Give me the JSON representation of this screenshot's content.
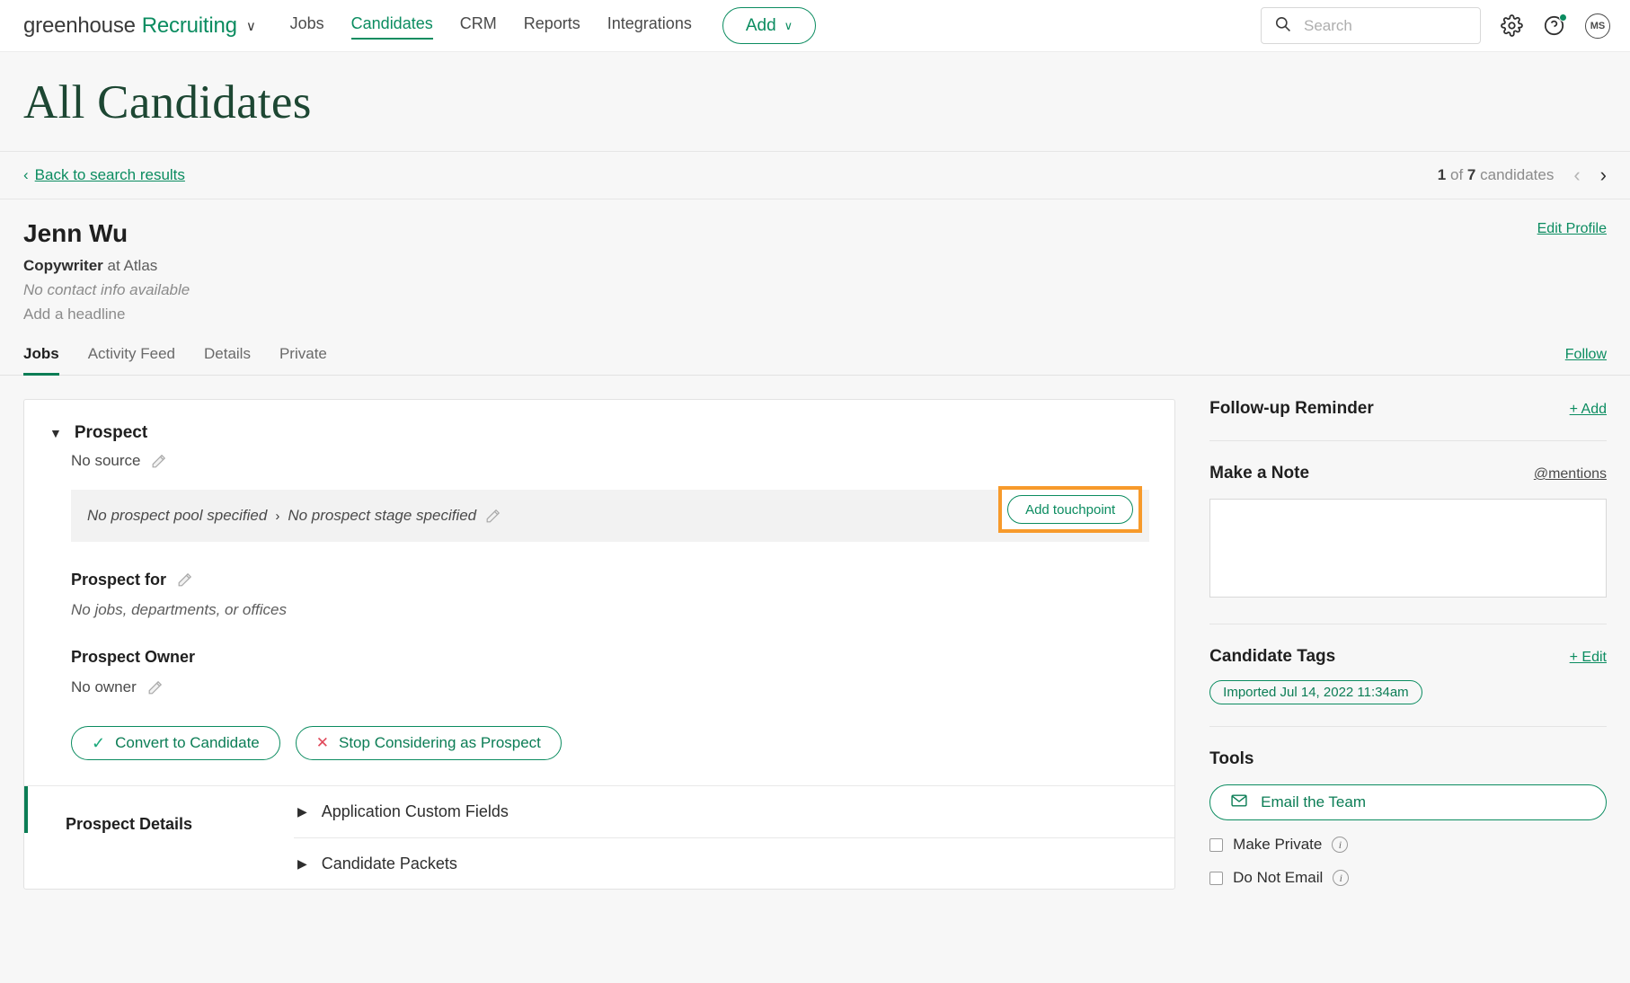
{
  "nav": {
    "brand_primary": "greenhouse",
    "brand_secondary": "Recruiting",
    "brand_caret": "∨",
    "links": [
      {
        "label": "Jobs",
        "active": false
      },
      {
        "label": "Candidates",
        "active": true
      },
      {
        "label": "CRM",
        "active": false
      },
      {
        "label": "Reports",
        "active": false
      },
      {
        "label": "Integrations",
        "active": false
      }
    ],
    "add_label": "Add",
    "add_caret": "∨",
    "search_placeholder": "Search",
    "search_value": "",
    "avatar_initials": "MS"
  },
  "page": {
    "title": "All Candidates",
    "back_label": "Back to search results",
    "back_chevron": "‹",
    "pager_current": "1",
    "pager_of": "of",
    "pager_total": "7",
    "pager_noun": "candidates",
    "pager_prev": "‹",
    "pager_next": "›"
  },
  "candidate": {
    "name": "Jenn Wu",
    "role": "Copywriter",
    "role_at": " at Atlas",
    "contact": "No contact info available",
    "headline": "Add a headline",
    "edit_profile": "Edit Profile",
    "follow": "Follow"
  },
  "tabs": [
    {
      "label": "Jobs",
      "active": true
    },
    {
      "label": "Activity Feed",
      "active": false
    },
    {
      "label": "Details",
      "active": false
    },
    {
      "label": "Private",
      "active": false
    }
  ],
  "prospect": {
    "collapse_caret": "▼",
    "title": "Prospect",
    "source": "No source",
    "pool": "No prospect pool specified",
    "stage_separator": "›",
    "stage": "No prospect stage specified",
    "add_touchpoint": "Add touchpoint",
    "prospect_for_label": "Prospect for",
    "prospect_for_value": "No jobs, departments, or offices",
    "owner_label": "Prospect Owner",
    "owner_value": "No owner",
    "convert_label": "Convert to Candidate",
    "convert_icon": "✓",
    "stop_label": "Stop Considering as Prospect",
    "stop_icon": "✕",
    "details_title": "Prospect Details",
    "accordions": [
      {
        "label": "Application Custom Fields",
        "caret": "▶"
      },
      {
        "label": "Candidate Packets",
        "caret": "▶"
      }
    ]
  },
  "sidebar": {
    "reminder_title": "Follow-up Reminder",
    "reminder_add": "+ Add",
    "note_title": "Make a Note",
    "note_mentions": "@mentions",
    "note_value": "",
    "note_placeholder": "",
    "tags_title": "Candidate Tags",
    "tags_edit": "+ Edit",
    "tags": [
      "Imported Jul 14, 2022 11:34am"
    ],
    "tools_title": "Tools",
    "email_team": "Email the Team",
    "make_private": "Make Private",
    "do_not_email": "Do Not Email",
    "info_glyph": "i"
  },
  "colors": {
    "brand_green": "#0b8c60",
    "title_green": "#1d4733",
    "highlight_orange": "#f79a2b",
    "danger_red": "#e0485a",
    "page_bg": "#f7f7f7"
  }
}
